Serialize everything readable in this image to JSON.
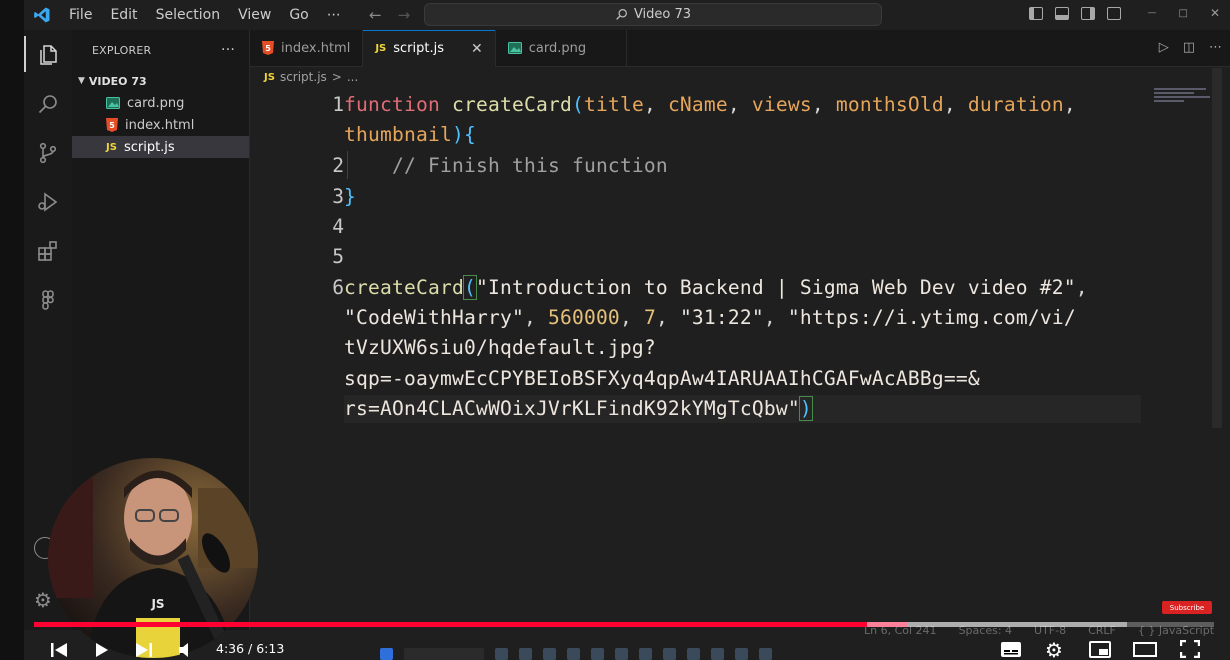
{
  "titlebar": {
    "menus": [
      "File",
      "Edit",
      "Selection",
      "View",
      "Go"
    ],
    "more": "⋯",
    "search_text": "Video 73",
    "window_controls": [
      "—",
      "□",
      "✕"
    ]
  },
  "activity_bar": [
    "explorer-icon",
    "search-icon",
    "source-control-icon",
    "run-debug-icon",
    "extensions-icon",
    "remote-icon",
    "account-icon",
    "settings-gear-icon"
  ],
  "sidebar": {
    "title": "EXPLORER",
    "more": "···",
    "folder": "VIDEO 73",
    "files": [
      {
        "name": "card.png",
        "icon": "image-file-icon",
        "selected": false
      },
      {
        "name": "index.html",
        "icon": "html-file-icon",
        "selected": false
      },
      {
        "name": "script.js",
        "icon": "js-file-icon",
        "selected": true
      }
    ]
  },
  "tabs": [
    {
      "label": "index.html",
      "icon": "html-file-icon",
      "active": false
    },
    {
      "label": "script.js",
      "icon": "js-file-icon",
      "active": true,
      "close": "✕"
    },
    {
      "label": "card.png",
      "icon": "image-file-icon",
      "active": false
    }
  ],
  "breadcrumb": {
    "js_badge": "JS",
    "file": "script.js",
    "sep": ">",
    "rest": "..."
  },
  "code": {
    "line_numbers": [
      "1",
      "2",
      "3",
      "4",
      "5",
      "6"
    ],
    "l1a": {
      "kw": "function",
      "fn": "createCard",
      "open": "(",
      "p1": "title",
      "p2": "cName",
      "p3": "views",
      "p4": "monthsOld",
      "p5": "duration",
      "comma": ","
    },
    "l1b": {
      "p6": "thumbnail",
      "close": "){"
    },
    "l2": {
      "comment": "// Finish this function"
    },
    "l3": {
      "brace": "}"
    },
    "l6a": {
      "fn": "createCard",
      "open": "(",
      "str": "\"Introduction to Backend | Sigma Web Dev video #2\"",
      "comma": ","
    },
    "l6b": {
      "str1": "\"CodeWithHarry\"",
      "n1": "560000",
      "n2": "7",
      "str2": "\"31:22\"",
      "str3": "\"https://i.ytimg.com/vi/"
    },
    "l6c": "tVzUXW6siu0/hqdefault.jpg?",
    "l6d": "sqp=-oaymwEcCPYBEIoBSFXyq4qpAw4IARUAAIhCGAFwAcABBg==&",
    "l6e": {
      "text": "rs=AOn4CLACwWOixJVrKLFindK92kYMgTcQbw\"",
      "close": ")"
    }
  },
  "statusbar": [
    "Ln 6, Col 241",
    "Spaces: 4",
    "UTF-8",
    "CRLF",
    "{ } JavaScript"
  ],
  "video": {
    "current_time": "4:36",
    "duration": "6:13",
    "time_display": "4:36 / 6:13",
    "progress_fraction": 0.74,
    "subscribe_label": "Subscribe"
  },
  "colors": {
    "accent": "#0078d4",
    "progress": "#ff0033",
    "js_yellow": "#f1d43a",
    "html_orange": "#e44d26"
  }
}
